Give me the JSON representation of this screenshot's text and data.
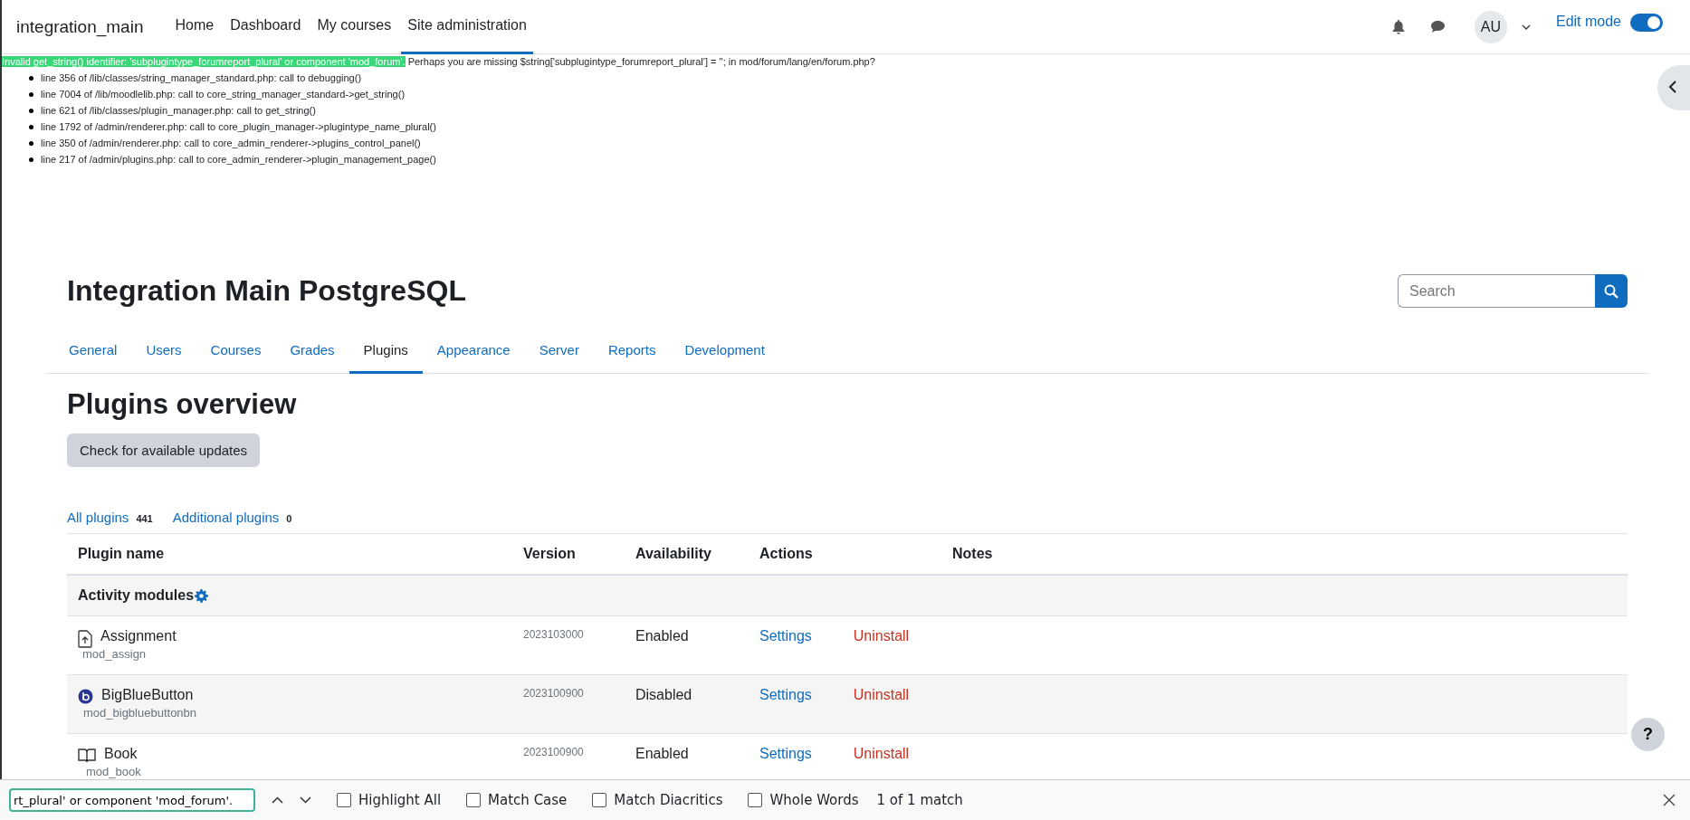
{
  "navbar": {
    "site_name": "integration_main",
    "items": [
      {
        "label": "Home",
        "selected": false
      },
      {
        "label": "Dashboard",
        "selected": false
      },
      {
        "label": "My courses",
        "selected": false
      },
      {
        "label": "Site administration",
        "selected": true
      }
    ],
    "avatar": "AU",
    "edit_mode": {
      "label": "Edit mode",
      "on": true
    }
  },
  "debug": {
    "highlighted": "Invalid get_string() identifier: 'subplugintype_forumreport_plural' or component 'mod_forum'.",
    "message": "Perhaps you are missing $string['subplugintype_forumreport_plural'] = ''; in mod/forum/lang/en/forum.php?",
    "trace": [
      "line 356 of /lib/classes/string_manager_standard.php: call to debugging()",
      "line 7004 of /lib/moodlelib.php: call to core_string_manager_standard->get_string()",
      "line 621 of /lib/classes/plugin_manager.php: call to get_string()",
      "line 1792 of /admin/renderer.php: call to core_plugin_manager->plugintype_name_plural()",
      "line 350 of /admin/renderer.php: call to core_admin_renderer->plugins_control_panel()",
      "line 217 of /admin/plugins.php: call to core_admin_renderer->plugin_management_page()"
    ]
  },
  "page_title": "Integration Main PostgreSQL",
  "search": {
    "placeholder": "Search"
  },
  "tabs": [
    {
      "label": "General",
      "selected": false
    },
    {
      "label": "Users",
      "selected": false
    },
    {
      "label": "Courses",
      "selected": false
    },
    {
      "label": "Grades",
      "selected": false
    },
    {
      "label": "Plugins",
      "selected": true
    },
    {
      "label": "Appearance",
      "selected": false
    },
    {
      "label": "Server",
      "selected": false
    },
    {
      "label": "Reports",
      "selected": false
    },
    {
      "label": "Development",
      "selected": false
    }
  ],
  "heading": "Plugins overview",
  "check_button": "Check for available updates",
  "filters": [
    {
      "label": "All plugins",
      "count": "441"
    },
    {
      "label": "Additional plugins",
      "count": "0"
    }
  ],
  "table": {
    "columns": [
      "Plugin name",
      "Version",
      "Availability",
      "Actions",
      "Notes"
    ],
    "group": "Activity modules",
    "rows": [
      {
        "kind": "assign",
        "name": "Assignment",
        "component": "mod_assign",
        "version": "2023103000",
        "availability": "Enabled",
        "settings": "Settings",
        "uninstall": "Uninstall"
      },
      {
        "kind": "bigbluebutton",
        "name": "BigBlueButton",
        "component": "mod_bigbluebuttonbn",
        "version": "2023100900",
        "availability": "Disabled",
        "settings": "Settings",
        "uninstall": "Uninstall"
      },
      {
        "kind": "book",
        "name": "Book",
        "component": "mod_book",
        "version": "2023100900",
        "availability": "Enabled",
        "settings": "Settings",
        "uninstall": "Uninstall"
      }
    ]
  },
  "help": "?",
  "find_bar": {
    "value": "rt_plural' or component 'mod_forum'.",
    "options": [
      {
        "label": "Highlight All",
        "checked": false
      },
      {
        "label": "Match Case",
        "checked": false
      },
      {
        "label": "Match Diacritics",
        "checked": false
      },
      {
        "label": "Whole Words",
        "checked": false
      }
    ],
    "result": "1 of 1 match"
  }
}
